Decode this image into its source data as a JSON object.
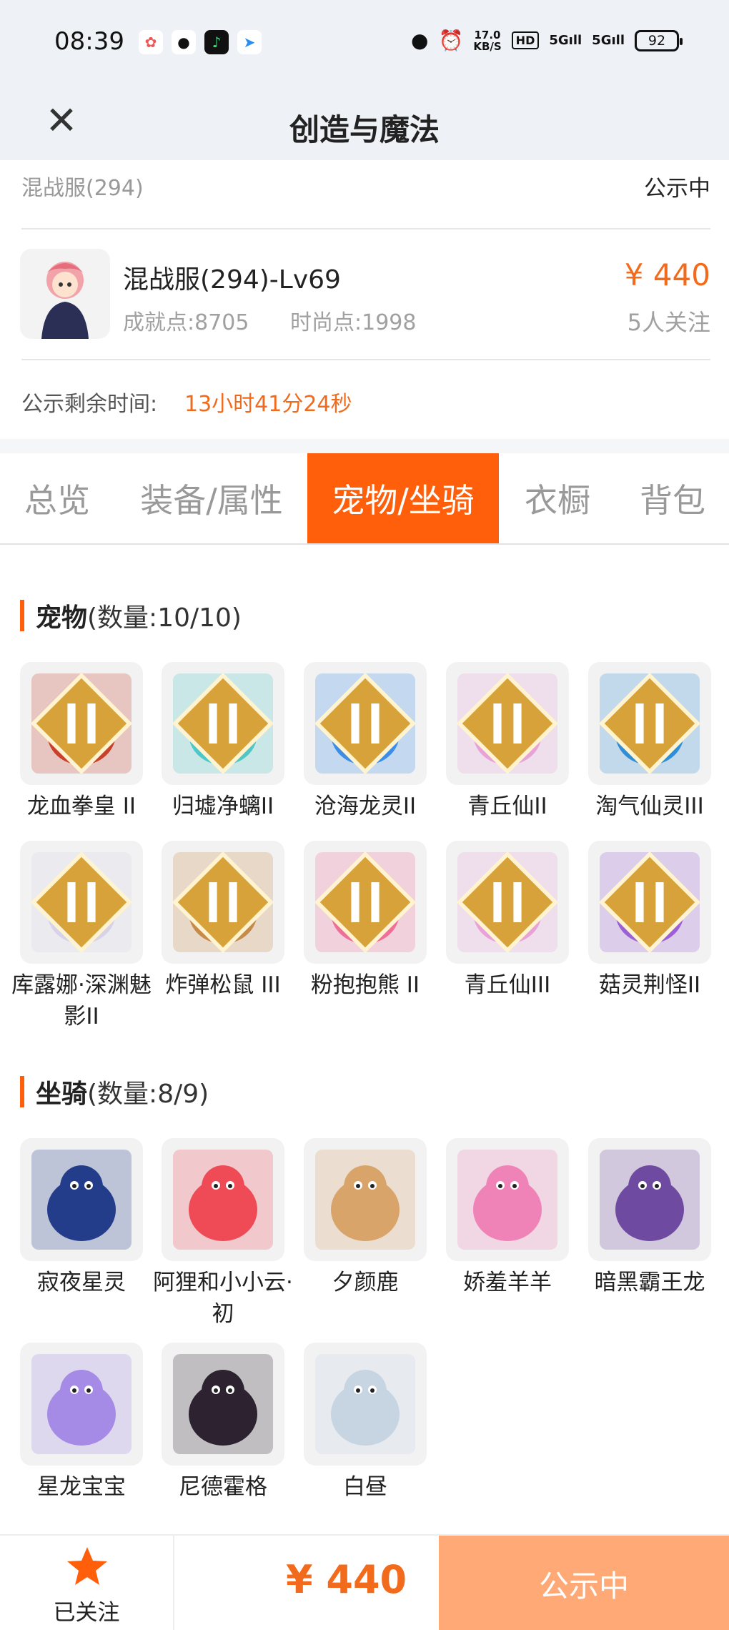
{
  "status_bar": {
    "time": "08:39",
    "speed": "17.0",
    "speed_unit": "KB/S",
    "hd": "HD",
    "signal1": "5G",
    "signal2": "5G",
    "battery": "92"
  },
  "nav": {
    "title": "创造与魔法",
    "close_icon": "close-icon"
  },
  "info": {
    "server": "混战服(294)",
    "status": "公示中",
    "role_name": "混战服(294)-Lv69",
    "achievement": "成就点:8705",
    "fashion": "时尚点:1998",
    "price": "¥ 440",
    "followers": "5人关注",
    "time_label": "公示剩余时间:",
    "time_value": "13小时41分24秒"
  },
  "tabs": [
    "总览",
    "装备/属性",
    "宠物/坐骑",
    "衣橱",
    "背包"
  ],
  "active_tab": "宠物/坐骑",
  "pets": {
    "title": "宠物",
    "count": "(数量:10/10)",
    "items": [
      {
        "name": "龙血拳皇 II",
        "color": "#c9412d"
      },
      {
        "name": "归墟净螭II",
        "color": "#4fc7c7"
      },
      {
        "name": "沧海龙灵II",
        "color": "#3b8ee8"
      },
      {
        "name": "青丘仙II",
        "color": "#e7a3d8"
      },
      {
        "name": "淘气仙灵III",
        "color": "#2f8ed8"
      },
      {
        "name": "库露娜·深渊魅影II",
        "color": "#d8d2e8"
      },
      {
        "name": "炸弹松鼠 III",
        "color": "#c68a4a"
      },
      {
        "name": "粉抱抱熊 II",
        "color": "#ee6f9a"
      },
      {
        "name": "青丘仙III",
        "color": "#e7a3d8"
      },
      {
        "name": "菇灵荆怪II",
        "color": "#9b5fd8"
      }
    ]
  },
  "mounts": {
    "title": "坐骑",
    "count": "(数量:8/9)",
    "items": [
      {
        "name": "寂夜星灵",
        "color": "#243d8a"
      },
      {
        "name": "阿狸和小小云·初",
        "color": "#ee4b57"
      },
      {
        "name": "夕颜鹿",
        "color": "#d9a46a"
      },
      {
        "name": "娇羞羊羊",
        "color": "#ef83b8"
      },
      {
        "name": "暗黑霸王龙",
        "color": "#6e4ba0"
      },
      {
        "name": "星龙宝宝",
        "color": "#a58ae6"
      },
      {
        "name": "尼德霍格",
        "color": "#2c2230"
      },
      {
        "name": "白昼",
        "color": "#c7d4e2"
      }
    ]
  },
  "bottom": {
    "fav_label": "已关注",
    "price": "¥ 440",
    "button": "公示中"
  },
  "colors": {
    "accent": "#ff5f0a",
    "price": "#f26b1d",
    "button_bg": "#ffa977"
  }
}
